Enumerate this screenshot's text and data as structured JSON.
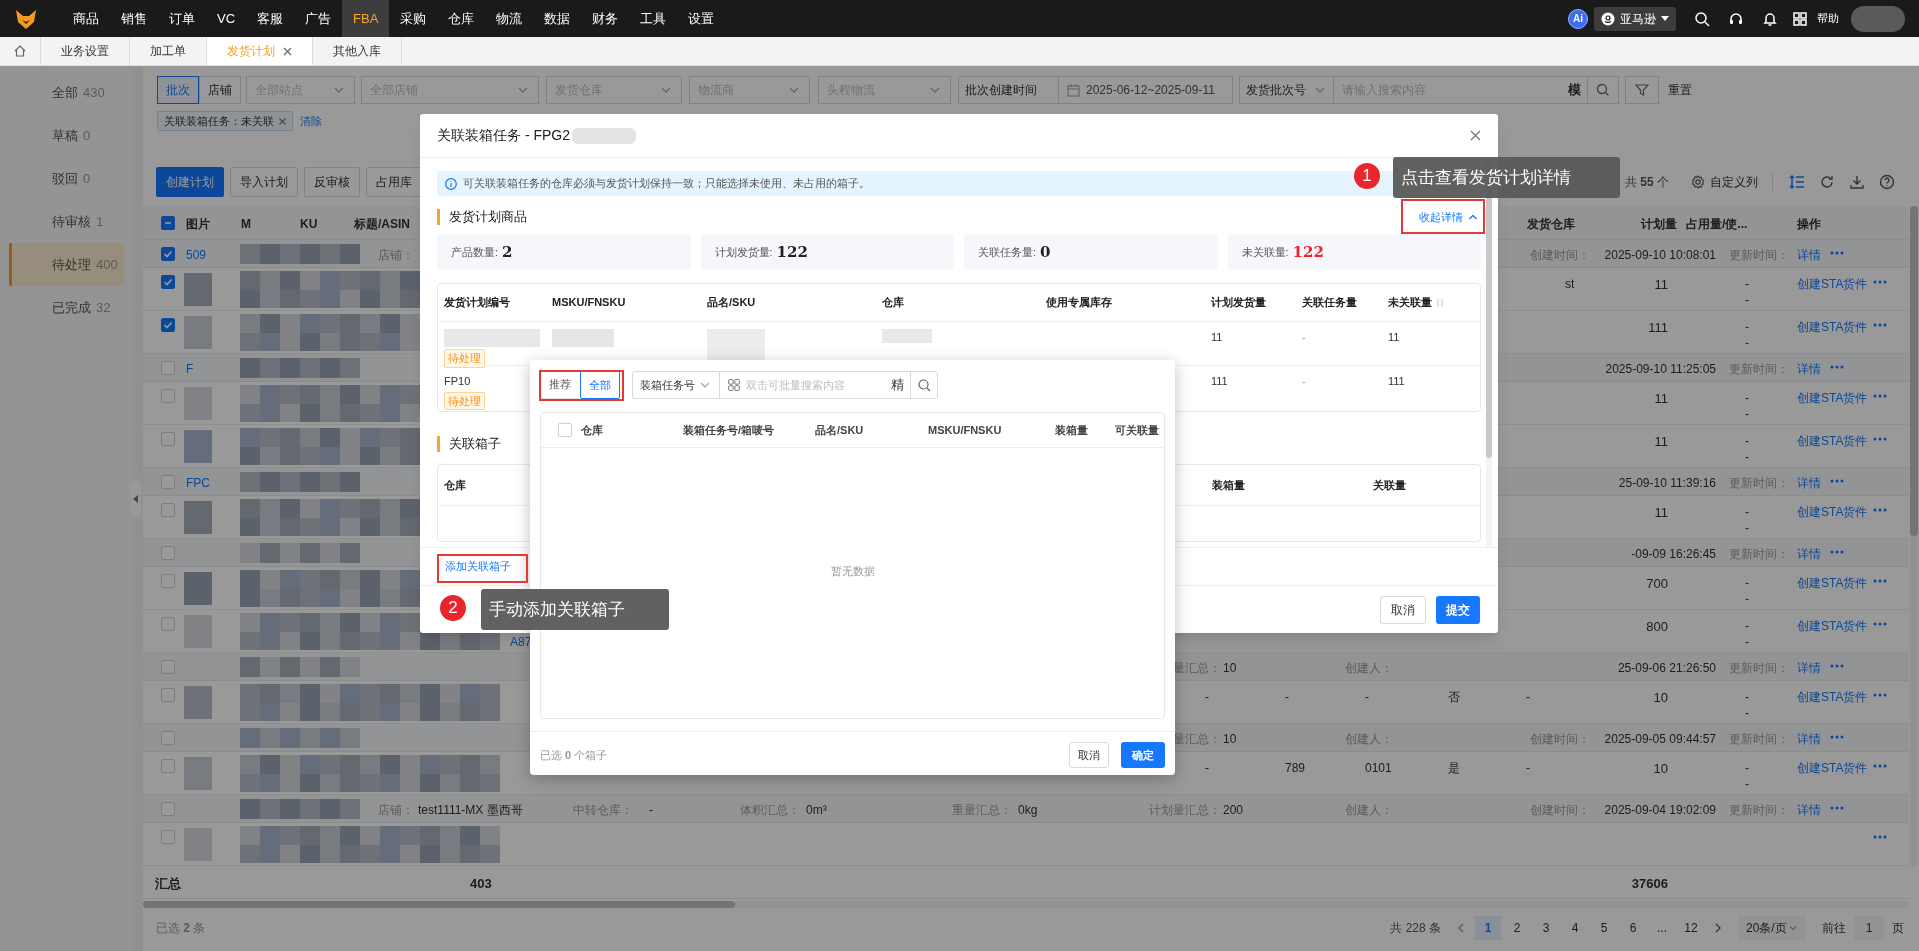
{
  "top_nav": {
    "items": [
      {
        "label": "商品",
        "selected": false
      },
      {
        "label": "销售",
        "selected": false
      },
      {
        "label": "订单",
        "selected": false
      },
      {
        "label": "VC",
        "selected": false
      },
      {
        "label": "客服",
        "selected": false
      },
      {
        "label": "广告",
        "selected": false
      },
      {
        "label": "FBA",
        "selected": true
      },
      {
        "label": "采购",
        "selected": false
      },
      {
        "label": "仓库",
        "selected": false
      },
      {
        "label": "物流",
        "selected": false
      },
      {
        "label": "数据",
        "selected": false
      },
      {
        "label": "财务",
        "selected": false
      },
      {
        "label": "工具",
        "selected": false
      },
      {
        "label": "设置",
        "selected": false
      }
    ],
    "ai_badge": "Ai",
    "platform": "亚马逊",
    "help": "帮助"
  },
  "tabs": [
    {
      "label": "业务设置",
      "selected": false,
      "closable": false
    },
    {
      "label": "加工单",
      "selected": false,
      "closable": false
    },
    {
      "label": "发货计划",
      "selected": true,
      "closable": true
    },
    {
      "label": "其他入库",
      "selected": false,
      "closable": false
    }
  ],
  "sidebar": {
    "items": [
      {
        "label": "全部",
        "count": "430",
        "selected": false
      },
      {
        "label": "草稿",
        "count": "0",
        "selected": false
      },
      {
        "label": "驳回",
        "count": "0",
        "selected": false
      },
      {
        "label": "待审核",
        "count": "1",
        "selected": false
      },
      {
        "label": "待处理",
        "count": "400",
        "selected": true
      },
      {
        "label": "已完成",
        "count": "32",
        "selected": false
      }
    ]
  },
  "filters": {
    "mode": [
      {
        "label": "批次",
        "selected": true
      },
      {
        "label": "店铺",
        "selected": false
      }
    ],
    "selects": [
      "全部站点",
      "全部店铺",
      "发货仓库",
      "物流商",
      "头程物流"
    ],
    "time_type": "批次创建时间",
    "date_range": "2025-06-12~2025-09-11",
    "search_type": "发货批次号",
    "search_placeholder": "请输入搜索内容",
    "match_mode": "模",
    "reset": "重置"
  },
  "active_filters": {
    "tags": [
      "关联装箱任务：未关联"
    ],
    "clear": "清除"
  },
  "toolbar": {
    "buttons": [
      {
        "label": "创建计划",
        "primary": true
      },
      {
        "label": "导入计划",
        "primary": false
      },
      {
        "label": "反审核",
        "primary": false
      },
      {
        "label": "占用库",
        "primary": false
      }
    ],
    "total": "共 **55** 个",
    "custom_columns": "自定义列"
  },
  "table": {
    "header_indeterminate": true,
    "columns": [
      "图片",
      "M",
      "KU",
      "标题/ASIN",
      "发货仓库",
      "计划量",
      "占用量/使...",
      "操作"
    ],
    "rows": [
      {
        "kind": "group",
        "checked": true,
        "plan_no": "509",
        "store_label": "店铺：",
        "created_label": "创建时间：",
        "created": "2025-09-10 10:08:01",
        "updated_label": "更新时间：",
        "action": "详情"
      },
      {
        "kind": "item",
        "checked": true,
        "warehouse": "st",
        "qty": "11",
        "used": [
          "-",
          "-"
        ],
        "action": "创建STA货件"
      },
      {
        "kind": "item",
        "checked": true,
        "qty": "111",
        "used": [
          "-",
          "-"
        ],
        "action": "创建STA货件"
      },
      {
        "kind": "group",
        "checked": false,
        "plan_no": "F",
        "created": "2025-09-10 11:25:05",
        "updated_label": "更新时间：",
        "action": "详情"
      },
      {
        "kind": "item",
        "checked": false,
        "qty": "11",
        "used": [
          "-",
          "-"
        ],
        "action": "创建STA货件"
      },
      {
        "kind": "item",
        "checked": false,
        "qty": "11",
        "used": [
          "-",
          "-"
        ],
        "action": "创建STA货件"
      },
      {
        "kind": "group",
        "checked": false,
        "plan_no": "FPC",
        "created": "25-09-10 11:39:16",
        "updated_label": "更新时间：",
        "action": "详情"
      },
      {
        "kind": "item",
        "checked": false,
        "qty": "11",
        "used": [
          "-",
          "-"
        ],
        "action": "创建STA货件"
      },
      {
        "kind": "group",
        "checked": false,
        "created": "-09-09 16:26:45",
        "updated_label": "更新时间：",
        "action": "详情"
      },
      {
        "kind": "item",
        "checked": false,
        "qty": "700",
        "used": [
          "-",
          "-"
        ],
        "action": "创建STA货件"
      },
      {
        "kind": "item",
        "checked": false,
        "asin": "A87",
        "qty": "800",
        "used": [
          "-",
          "-"
        ],
        "action": "创建STA货件"
      },
      {
        "kind": "group",
        "checked": false,
        "plan_label": "量汇总：",
        "plan": "10",
        "creator_label": "创建人：",
        "created": "25-09-06 21:26:50",
        "updated_label": "更新时间：",
        "action": "详情"
      },
      {
        "kind": "item",
        "checked": false,
        "cells": [
          "-",
          "-",
          "-",
          "否",
          "-"
        ],
        "qty": "10",
        "used": [
          "-",
          "-"
        ],
        "action": "创建STA货件"
      },
      {
        "kind": "group",
        "checked": false,
        "plan_label": "量汇总：",
        "plan": "10",
        "creator_label": "创建人：",
        "created_label": "创建时间：",
        "created": "2025-09-05 09:44:57",
        "updated_label": "更新时间：",
        "action": "详情"
      },
      {
        "kind": "item",
        "checked": false,
        "cells": [
          "-",
          "789",
          "0101",
          "是",
          "-"
        ],
        "qty": "10",
        "used": [
          "-",
          "-"
        ],
        "action": "创建STA货件"
      },
      {
        "kind": "group",
        "checked": false,
        "store_label": "店铺：",
        "store": "test1111-MX 墨西哥",
        "transit_label": "中转仓库：",
        "transit": "-",
        "volume_label": "体积汇总：",
        "volume": "0m³",
        "weight_label": "重量汇总：",
        "weight": "0kg",
        "plan_label": "计划量汇总：",
        "plan": "200",
        "creator_label": "创建人：",
        "created_label": "创建时间：",
        "created": "2025-09-04 19:02:09",
        "updated_label": "更新时间：",
        "action": "详情"
      },
      {
        "kind": "item",
        "checked": false
      }
    ],
    "summary": {
      "label": "汇总",
      "count": "403",
      "plan_total": "37606"
    }
  },
  "footer": {
    "selected": "已选 **2** 条"
  },
  "pagination": {
    "total": "共 228 条",
    "pages": [
      {
        "label": "1",
        "selected": true
      },
      {
        "label": "2",
        "selected": false
      },
      {
        "label": "3",
        "selected": false
      },
      {
        "label": "4",
        "selected": false
      },
      {
        "label": "5",
        "selected": false
      },
      {
        "label": "6",
        "selected": false
      },
      {
        "label": "...",
        "selected": false
      },
      {
        "label": "12",
        "selected": false
      }
    ],
    "page_size": "20条/页",
    "goto_label": "前往",
    "goto_value": "1",
    "goto_suffix": "页"
  },
  "modal": {
    "title": "关联装箱任务 - FPG2",
    "notice": "可关联装箱任务的仓库必须与发货计划保持一致；只能选择未使用、未占用的箱子。",
    "products_title": "发货计划商品",
    "collapse": "收起详情",
    "stats": [
      {
        "label": "产品数量:",
        "value": "2",
        "alert": false
      },
      {
        "label": "计划发货量:",
        "value": "122",
        "alert": false
      },
      {
        "label": "关联任务量:",
        "value": "0",
        "alert": false
      },
      {
        "label": "未关联量:",
        "value": "122",
        "alert": true
      }
    ],
    "product_columns": [
      "发货计划编号",
      "MSKU/FNSKU",
      "品名/SKU",
      "仓库",
      "使用专属库存",
      "计划发货量",
      "关联任务量",
      "未关联量"
    ],
    "product_rows": [
      {
        "status": "待处理",
        "plan_qty": "11",
        "linked": "-",
        "unlinked": "11"
      },
      {
        "plan_no": "FP10",
        "status": "待处理",
        "plan_qty": "111",
        "linked": "-",
        "unlinked": "111"
      }
    ],
    "boxes_title": "关联箱子",
    "box_columns": [
      "仓库",
      "装箱量",
      "关联量"
    ],
    "add_button": "添加关联箱子",
    "cancel": "取消",
    "submit": "提交"
  },
  "box_picker": {
    "modes": [
      {
        "label": "推荐",
        "selected": false
      },
      {
        "label": "全部",
        "selected": true
      }
    ],
    "search_type": "装箱任务号",
    "search_placeholder": "双击可批量搜索内容",
    "exact": "精",
    "header_checked": false,
    "columns": [
      "仓库",
      "装箱任务号/箱唛号",
      "品名/SKU",
      "MSKU/FNSKU",
      "装箱量",
      "可关联量"
    ],
    "empty": "暂无数据",
    "selected_text": "已选 **0** 个箱子",
    "cancel": "取消",
    "confirm": "确定"
  },
  "guides": [
    {
      "number": "1",
      "text": "点击查看发货计划详情"
    },
    {
      "number": "2",
      "text": "手动添加关联箱子"
    }
  ]
}
